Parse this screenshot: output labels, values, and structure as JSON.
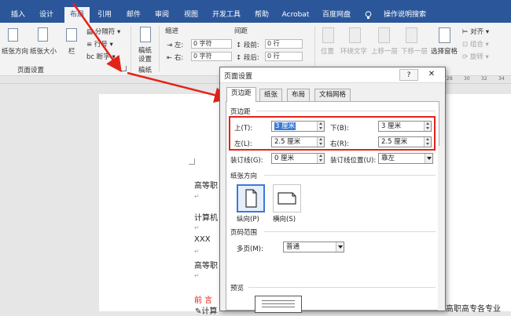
{
  "ribbon_tabs": [
    "插入",
    "设计",
    "布局",
    "引用",
    "邮件",
    "审阅",
    "视图",
    "开发工具",
    "帮助",
    "Acrobat",
    "百度网盘",
    "操作说明搜索"
  ],
  "active_tab": "布局",
  "ribbon": {
    "orientation": "纸张方向",
    "size": "纸张大小",
    "columns": "栏",
    "breaks": "分隔符",
    "line_numbers": "行号",
    "hyphenation": "断字",
    "group_page_setup": "页面设置",
    "manuscript_top": "稿纸",
    "manuscript_bottom": "设置",
    "group_manuscript": "稿纸",
    "indent_title": "缩进",
    "spacing_title": "间距",
    "indent_left_label": "左:",
    "indent_left_value": "0 字符",
    "indent_right_label": "右:",
    "indent_right_value": "0 字符",
    "spacing_before_label": "段前:",
    "spacing_before_value": "0 行",
    "spacing_after_label": "段后:",
    "spacing_after_value": "0 行",
    "position": "位置",
    "wrap_text": "环绕文字",
    "bring_forward": "上移一层",
    "send_backward": "下移一层",
    "selection_pane": "选择窗格",
    "align": "对齐",
    "group": "组合",
    "rotate": "旋转"
  },
  "ruler_ticks": [
    "28",
    "30",
    "32",
    "34"
  ],
  "doc": {
    "line1": "高等职",
    "line2": "计算机",
    "line3": "XXX",
    "line4": "高等职",
    "line5": "前 言",
    "line6": "计算",
    "line6_right": "高职高专各专业"
  },
  "dialog": {
    "title": "页面设置",
    "help_icon": "?",
    "close_icon": "✕",
    "tabs": [
      "页边距",
      "纸张",
      "布局",
      "文档网格"
    ],
    "margins_section": "页边距",
    "top_label": "上(T):",
    "top_value": "3 厘米",
    "bottom_label": "下(B):",
    "bottom_value": "3 厘米",
    "left_label": "左(L):",
    "left_value": "2.5 厘米",
    "right_label": "右(R):",
    "right_value": "2.5 厘米",
    "gutter_label": "装订线(G):",
    "gutter_value": "0 厘米",
    "gutter_pos_label": "装订线位置(U):",
    "gutter_pos_value": "靠左",
    "orientation_section": "纸张方向",
    "portrait": "纵向(P)",
    "landscape": "横向(S)",
    "pages_section": "页码范围",
    "multi_pages_label": "多页(M):",
    "multi_pages_value": "普通",
    "preview_section": "预览"
  },
  "colors": {
    "accent": "#2b579a",
    "highlight": "#e2231a"
  }
}
